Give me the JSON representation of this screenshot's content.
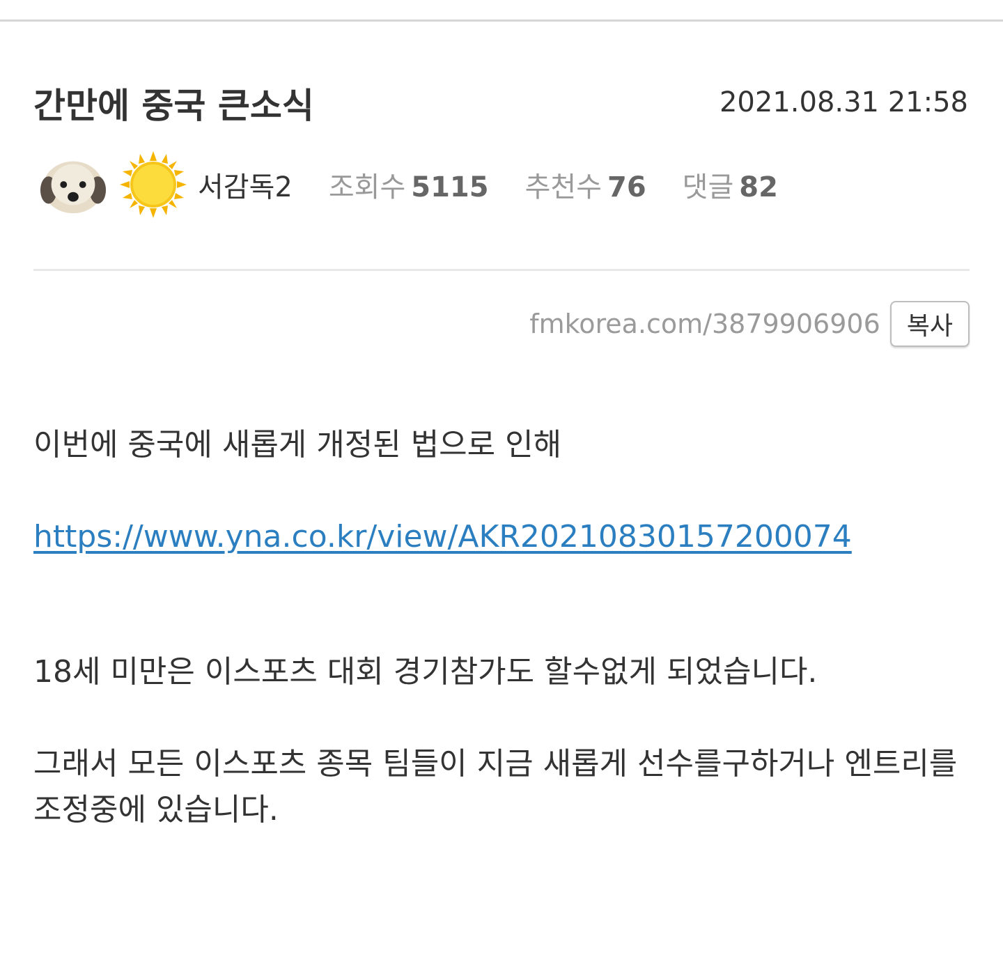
{
  "post": {
    "title": "간만에 중국 큰소식",
    "date": "2021.08.31 21:58",
    "author": "서감독2",
    "views_label": "조회수",
    "views_value": "5115",
    "recommend_label": "추천수",
    "recommend_value": "76",
    "comments_label": "댓글",
    "comments_value": "82",
    "avatar_icon": "puppy-face-icon",
    "level_icon": "sun-icon"
  },
  "share": {
    "short_url": "fmkorea.com/3879906906",
    "copy_label": "복사"
  },
  "content": {
    "paragraph_1": "이번에 중국에 새롭게 개정된 법으로 인해",
    "link": "https://www.yna.co.kr/view/AKR20210830157200074",
    "paragraph_2": "18세 미만은 이스포츠 대회 경기참가도 할수없게 되었습니다.",
    "paragraph_3": "그래서 모든 이스포츠 종목 팀들이 지금 새롭게 선수를구하거나 엔트리를 조정중에 있습니다."
  },
  "colors": {
    "link": "#2b7fc0",
    "muted": "#999999",
    "text": "#333333"
  }
}
